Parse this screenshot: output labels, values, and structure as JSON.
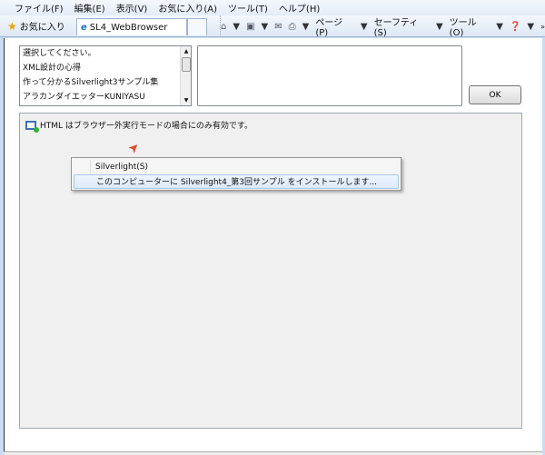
{
  "menu": [
    "ファイル(F)",
    "編集(E)",
    "表示(V)",
    "お気に入り(A)",
    "ツール(T)",
    "ヘルプ(H)"
  ],
  "toolbar": {
    "favorites": "お気に入り",
    "tab_title": "SL4_WebBrowser",
    "page": "ページ(P)",
    "safety": "セーフティ(S)",
    "tools": "ツール(O)"
  },
  "listbox": [
    "選択してください。",
    "XML設計の心得",
    "作って分かるSilverlight3サンプル集",
    "アラカンダイエッターKUNIYASU"
  ],
  "textbox_value": "",
  "ok_label": "OK",
  "notice": "HTML はブラウザー外実行モードの場合にのみ有効です。",
  "context_menu": [
    "Silverlight(S)",
    "このコンピューターに Silverlight4_第3回サンプル をインストールします..."
  ]
}
